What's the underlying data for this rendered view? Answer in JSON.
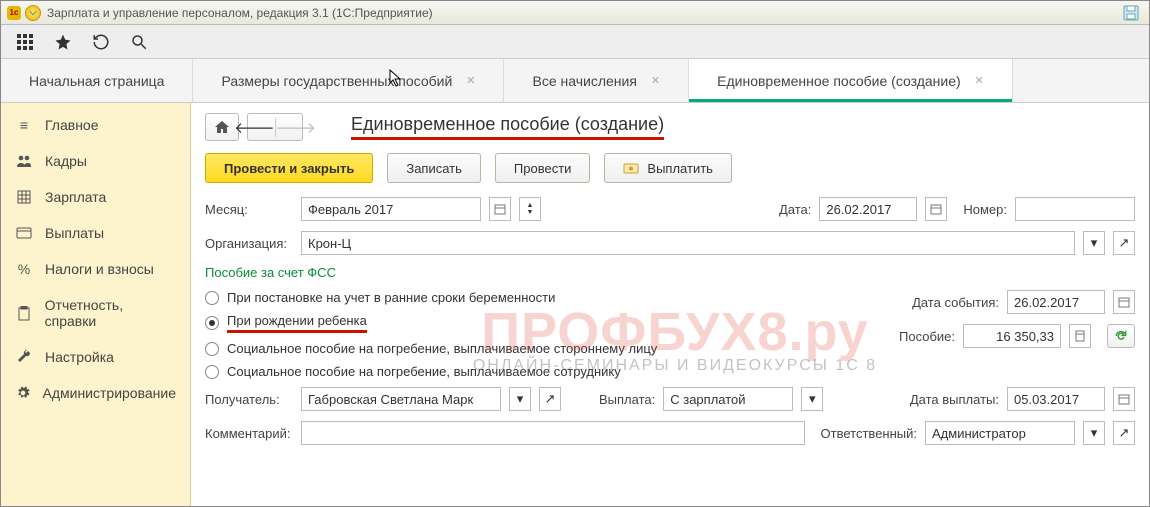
{
  "window_title": "Зарплата и управление персоналом, редакция 3.1  (1С:Предприятие)",
  "tabs": [
    {
      "label": "Начальная страница",
      "closable": false
    },
    {
      "label": "Размеры государственных пособий",
      "closable": true
    },
    {
      "label": "Все начисления",
      "closable": true
    },
    {
      "label": "Единовременное пособие (создание)",
      "closable": true,
      "active": true
    }
  ],
  "sidebar": [
    {
      "label": "Главное",
      "icon": "menu"
    },
    {
      "label": "Кадры",
      "icon": "people"
    },
    {
      "label": "Зарплата",
      "icon": "table"
    },
    {
      "label": "Выплаты",
      "icon": "card"
    },
    {
      "label": "Налоги и взносы",
      "icon": "percent"
    },
    {
      "label": "Отчетность, справки",
      "icon": "clipboard"
    },
    {
      "label": "Настройка",
      "icon": "wrench"
    },
    {
      "label": "Администрирование",
      "icon": "gear"
    }
  ],
  "page": {
    "title": "Единовременное пособие (создание)",
    "buttons": {
      "post_close": "Провести и закрыть",
      "save": "Записать",
      "post": "Провести",
      "pay": "Выплатить"
    },
    "labels": {
      "month": "Месяц:",
      "date": "Дата:",
      "number": "Номер:",
      "org": "Организация:",
      "section": "Пособие за счет ФСС",
      "event_date": "Дата события:",
      "benefit": "Пособие:",
      "recipient": "Получатель:",
      "payout": "Выплата:",
      "payout_date": "Дата выплаты:",
      "comment": "Комментарий:",
      "responsible": "Ответственный:"
    },
    "values": {
      "month": "Февраль 2017",
      "date": "26.02.2017",
      "number": "",
      "org": "Крон-Ц",
      "event_date": "26.02.2017",
      "benefit": "16 350,33",
      "recipient": "Габровская Светлана Марк",
      "payout": "С зарплатой",
      "payout_date": "05.03.2017",
      "comment": "",
      "responsible": "Администратор"
    },
    "radios": [
      {
        "label": "При постановке на учет в ранние сроки беременности",
        "checked": false
      },
      {
        "label": "При рождении ребенка",
        "checked": true,
        "underline": true
      },
      {
        "label": "Социальное пособие на погребение, выплачиваемое стороннему лицу",
        "checked": false
      },
      {
        "label": "Социальное пособие на погребение, выплачиваемое сотруднику",
        "checked": false
      }
    ]
  },
  "watermark": {
    "l1": "ПРОФБУХ8.ру",
    "l2": "ОНЛАЙН-СЕМИНАРЫ И ВИДЕОКУРСЫ 1С 8"
  }
}
